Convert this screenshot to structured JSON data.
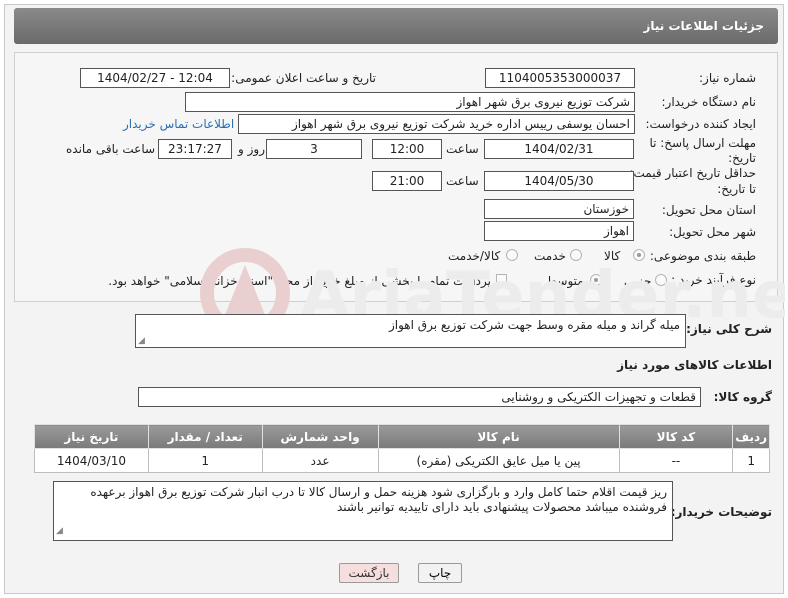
{
  "header": {
    "title": "جزئیات اطلاعات نیاز"
  },
  "fields": {
    "need_number_label": "شماره نیاز:",
    "need_number": "1104005353000037",
    "announce_label": "تاریخ و ساعت اعلان عمومی:",
    "announce_value": "1404/02/27 - 12:04",
    "buyer_org_label": "نام دستگاه خریدار:",
    "buyer_org": "شرکت توزیع نیروی برق شهر اهواز",
    "requester_label": "ایجاد کننده درخواست:",
    "requester": "احسان یوسفی رییس اداره خرید شرکت توزیع نیروی برق شهر اهواز",
    "contact_link": "اطلاعات تماس خریدار",
    "reply_deadline_label_1": "مهلت ارسال پاسخ: تا",
    "reply_deadline_label_2": "تاریخ:",
    "reply_date": "1404/02/31",
    "time_label": "ساعت",
    "reply_time": "12:00",
    "days_value": "3",
    "days_label": "روز و",
    "remaining_time": "23:17:27",
    "remaining_label": "ساعت باقی مانده",
    "validity_label_1": "حداقل تاریخ اعتبار قیمت:",
    "validity_label_2": "تا تاریخ:",
    "validity_date": "1404/05/30",
    "validity_time": "21:00",
    "province_label": "استان محل تحویل:",
    "province": "خوزستان",
    "city_label": "شهر محل تحویل:",
    "city": "اهواز",
    "category_label": "طبقه بندی موضوعی:",
    "category_options": [
      "کالا",
      "خدمت",
      "کالا/خدمت"
    ],
    "category_selected": "کالا",
    "process_label": "نوع فرآیند خرید :",
    "process_options": [
      "جزیی",
      "متوسط"
    ],
    "process_selected": "متوسط",
    "payment_note": "پرداخت تمام یا بخشی از مبلغ خرید،از محل \"اسناد خزانه اسلامی\" خواهد بود."
  },
  "description": {
    "label": "شرح کلی نیاز:",
    "text": "میله گراند و میله مقره وسط جهت شرکت توزیع برق اهواز"
  },
  "goods_section": {
    "title": "اطلاعات کالاهای مورد نیاز",
    "group_label": "گروه کالا:",
    "group_value": "قطعات و تجهیزات الکتریکی و روشنایی"
  },
  "table": {
    "headers": [
      "ردیف",
      "کد کالا",
      "نام کالا",
      "واحد شمارش",
      "تعداد / مقدار",
      "تاریخ نیاز"
    ],
    "rows": [
      [
        "1",
        "--",
        "پین یا میل عایق الکتریکی (مقره)",
        "عدد",
        "1",
        "1404/03/10"
      ]
    ]
  },
  "buyer_notes": {
    "label": "توضیحات خریدار:",
    "text": "ریز قیمت اقلام حتما کامل وارد و بارگزاری شود هزینه حمل و ارسال کالا تا درب انبار شرکت توزیع برق اهواز برعهده فروشنده میباشد محصولات پیشنهادی باید دارای تاییدیه توانیر باشند"
  },
  "buttons": {
    "print": "چاپ",
    "back": "بازگشت"
  },
  "colors": {
    "header_bg": "#777777",
    "link": "#2a6fb0",
    "back_btn": "#f7dede"
  }
}
